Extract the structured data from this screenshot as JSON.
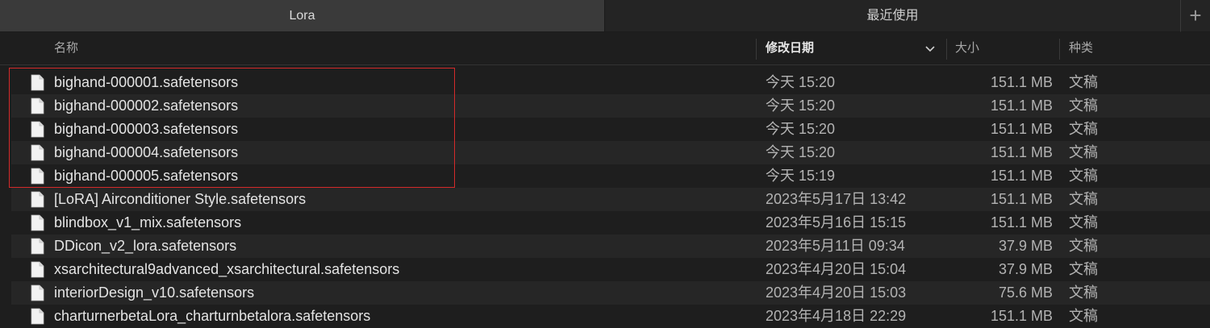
{
  "tabs": [
    {
      "label": "Lora",
      "active": true
    },
    {
      "label": "最近使用",
      "active": false
    }
  ],
  "new_tab_label": "+",
  "columns": {
    "name": "名称",
    "date": "修改日期",
    "size": "大小",
    "kind": "种类"
  },
  "files": [
    {
      "name": "bighand-000001.safetensors",
      "date": "今天 15:20",
      "size": "151.1 MB",
      "kind": "文稿"
    },
    {
      "name": "bighand-000002.safetensors",
      "date": "今天 15:20",
      "size": "151.1 MB",
      "kind": "文稿"
    },
    {
      "name": "bighand-000003.safetensors",
      "date": "今天 15:20",
      "size": "151.1 MB",
      "kind": "文稿"
    },
    {
      "name": "bighand-000004.safetensors",
      "date": "今天 15:20",
      "size": "151.1 MB",
      "kind": "文稿"
    },
    {
      "name": "bighand-000005.safetensors",
      "date": "今天 15:19",
      "size": "151.1 MB",
      "kind": "文稿"
    },
    {
      "name": "[LoRA] Airconditioner Style.safetensors",
      "date": "2023年5月17日 13:42",
      "size": "151.1 MB",
      "kind": "文稿"
    },
    {
      "name": "blindbox_v1_mix.safetensors",
      "date": "2023年5月16日 15:15",
      "size": "151.1 MB",
      "kind": "文稿"
    },
    {
      "name": "DDicon_v2_lora.safetensors",
      "date": "2023年5月11日 09:34",
      "size": "37.9 MB",
      "kind": "文稿"
    },
    {
      "name": "xsarchitectural9advanced_xsarchitectural.safetensors",
      "date": "2023年4月20日 15:04",
      "size": "37.9 MB",
      "kind": "文稿"
    },
    {
      "name": "interiorDesign_v10.safetensors",
      "date": "2023年4月20日 15:03",
      "size": "75.6 MB",
      "kind": "文稿"
    },
    {
      "name": "charturnerbetaLora_charturnbetalora.safetensors",
      "date": "2023年4月18日 22:29",
      "size": "151.1 MB",
      "kind": "文稿"
    }
  ],
  "colors": {
    "background": "#1e1e1e",
    "highlight_box": "#d42a2a"
  },
  "icons": {
    "file": "document-icon",
    "sort": "chevron-down-icon",
    "new_tab": "plus-icon"
  }
}
